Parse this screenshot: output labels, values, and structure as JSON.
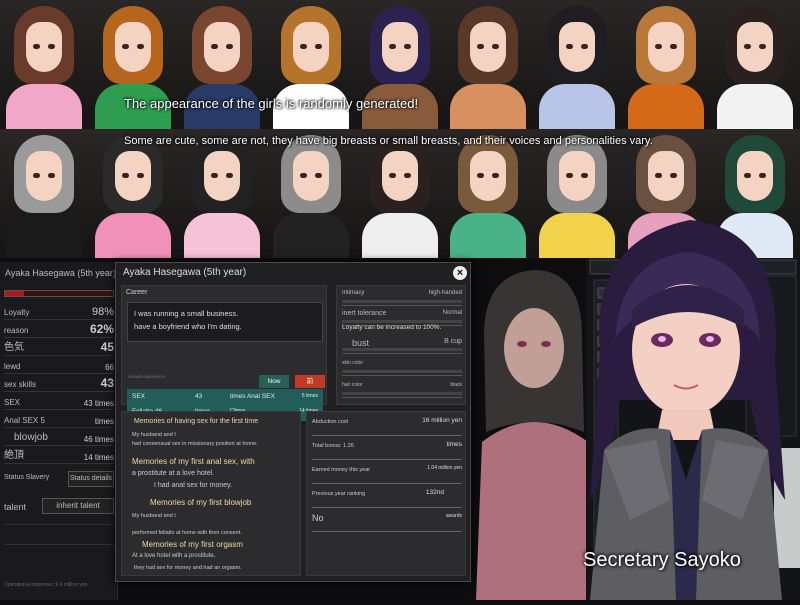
{
  "captions": {
    "line1": "The appearance of the girls is randomly generated!",
    "line2": "Some are cute, some are not, they have big breasts or small breasts, and their voices and personalities vary."
  },
  "portraits": {
    "row1": [
      {
        "hair": "#6a3b2a",
        "body": "#f1a8c8"
      },
      {
        "hair": "#b5651d",
        "body": "#2e9d4f"
      },
      {
        "hair": "#7a4630",
        "body": "#2a3a66"
      },
      {
        "hair": "#b5742c",
        "body": "#ffffff"
      },
      {
        "hair": "#2b2250",
        "body": "#8a5a3c"
      },
      {
        "hair": "#5a3828",
        "body": "#d99060"
      },
      {
        "hair": "#1e1e22",
        "body": "#b8c4e8"
      },
      {
        "hair": "#b9773a",
        "body": "#d46a18"
      },
      {
        "hair": "#2a2020",
        "body": "#f2f2f2"
      }
    ],
    "row2": [
      {
        "hair": "#9a9a9a",
        "body": "#1a1a1a"
      },
      {
        "hair": "#2a2a2a",
        "body": "#f190b8"
      },
      {
        "hair": "#222222",
        "body": "#f6c2d8"
      },
      {
        "hair": "#8c8c8c",
        "body": "#222222"
      },
      {
        "hair": "#2a2020",
        "body": "#eeeeee"
      },
      {
        "hair": "#7a5a3a",
        "body": "#49b387"
      },
      {
        "hair": "#8a8a8a",
        "body": "#f1d24a"
      },
      {
        "hair": "#6a5040",
        "body": "#e8a0c0"
      },
      {
        "hair": "#1f4a3a",
        "body": "#e0eaf6"
      }
    ]
  },
  "left_panel": {
    "name": "Ayaka Hasegawa (5th year)",
    "rows": [
      {
        "key": "Loyalty",
        "value": "98%"
      },
      {
        "key": "reason",
        "value": "62%"
      },
      {
        "key": "色気",
        "value": "45"
      },
      {
        "key": "lewd",
        "value": "66"
      },
      {
        "key": "sex skills",
        "value": "43"
      },
      {
        "key": "SEX",
        "value": "43 times"
      },
      {
        "key": "Anal SEX 5",
        "value": "times"
      },
      {
        "key": "blowjob",
        "value": "46 times"
      },
      {
        "key": "絶頂",
        "value": "14 times"
      }
    ],
    "status_label": "Status Slavery",
    "status_button": "Status details",
    "talent_label": "talent",
    "talent_button": "inherit talent",
    "footer": "Operational expenses: 9.6 million yen"
  },
  "dialog": {
    "title": "Ayaka Hasegawa (5th year)",
    "close_label": "×",
    "career_label": "Career",
    "career_text": [
      "I was running a small business.",
      "have a boyfriend who I'm dating."
    ],
    "tab_now": "Now",
    "tab_prev": "前",
    "small_label": "Sexual experience",
    "sex": {
      "label": "SEX",
      "value": "43",
      "mid": "times Anal SEX",
      "right": "5 times"
    },
    "fellatio": {
      "label": "Fellatio 46",
      "value": "times",
      "mid": "Climax",
      "right": "14 times"
    },
    "stats": [
      {
        "key": "Intimacy",
        "value": "high-handed"
      },
      {
        "key": "inert tolerance",
        "value": "Normal"
      },
      {
        "key": "Loyalty can be increased to 100%.",
        "value": ""
      },
      {
        "key": "bust",
        "value": "B cup"
      },
      {
        "key": "skin color",
        "value": ""
      },
      {
        "key": "hair color",
        "value": "black"
      }
    ],
    "memories": [
      {
        "head": "Memories of having sex for the first time",
        "lines": [
          "My husband and I",
          "had consensual sex in missionary position at home."
        ]
      },
      {
        "head": "Memories of my first anal sex, with",
        "lines": [
          "a prostitute at a love hotel.",
          "I had anal sex for money."
        ]
      },
      {
        "head": "Memories of my first blowjob",
        "lines": [
          "My husband and I",
          "performed fellatio at home with their consent."
        ]
      },
      {
        "head": "Memories of my first orgasm",
        "lines": [
          "At a love hotel with a prostitute,",
          "they had sex for money and had an orgasm."
        ]
      }
    ],
    "right_stats": [
      {
        "key": "Abduction cost",
        "value": "16 million yen"
      },
      {
        "key": "Total bonus: 1.26",
        "value": "times"
      },
      {
        "key": "Earned money this year",
        "value": "1.04 million yen"
      },
      {
        "key": "Previous year ranking",
        "value": "132nd"
      },
      {
        "key": "No",
        "value": "awards"
      }
    ]
  },
  "secretary": {
    "label": "Secretary Sayoko"
  }
}
